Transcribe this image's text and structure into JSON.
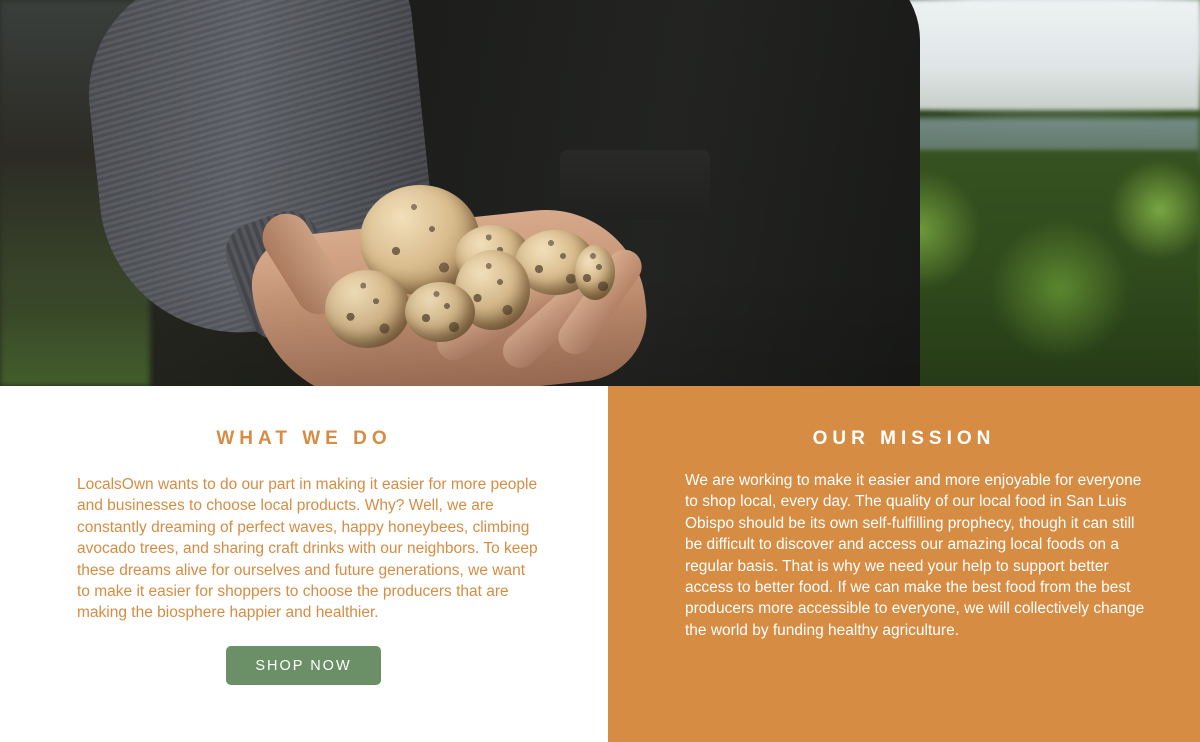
{
  "hero": {
    "image_subject": "hands holding freshly dug potatoes"
  },
  "what_we_do": {
    "heading": "WHAT WE DO",
    "body": "LocalsOwn wants to do our part in making it easier for more people and businesses to choose local products. Why? Well, we are constantly dreaming of perfect waves, happy honeybees, climbing avocado trees, and sharing craft drinks with our neighbors. To keep these dreams alive for ourselves and future generations, we want to make it easier for shoppers to choose the producers that are making the biosphere happier and healthier.",
    "button_label": "SHOP NOW"
  },
  "our_mission": {
    "heading": "OUR MISSION",
    "body": "We are working to make it easier and more enjoyable for everyone to shop local, every day. The quality of our local food in San Luis Obispo should be its own self-fulfilling prophecy, though it can still be difficult to discover and access our amazing local foods on a regular basis. That is why we need your help to support better access to better food. If we can make the best food from the best producers more accessible to everyone, we will collectively change the world by funding healthy agriculture."
  },
  "colors": {
    "accent_orange": "#d68c43",
    "button_green": "#6b8f66",
    "text_white": "#ffffff"
  }
}
